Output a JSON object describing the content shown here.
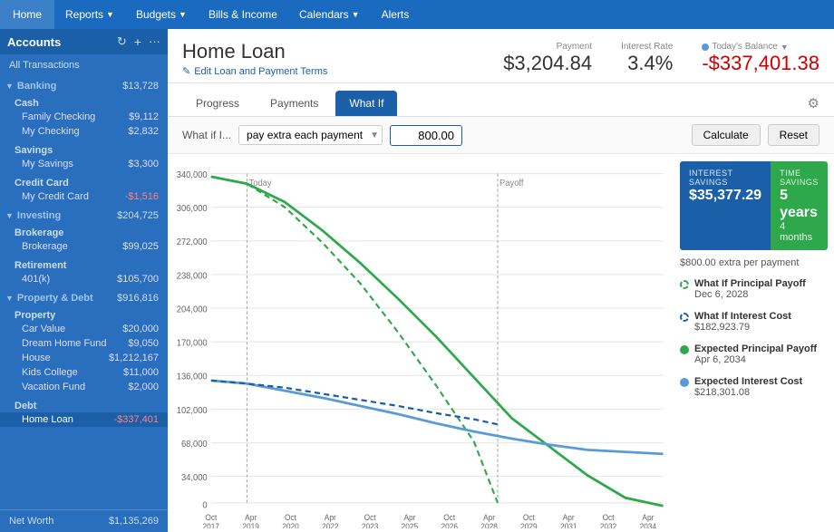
{
  "nav": {
    "items": [
      {
        "label": "Home",
        "active": false
      },
      {
        "label": "Reports",
        "hasMenu": true
      },
      {
        "label": "Budgets",
        "hasMenu": true
      },
      {
        "label": "Bills & Income",
        "hasMenu": false
      },
      {
        "label": "Calendars",
        "hasMenu": true
      },
      {
        "label": "Alerts",
        "hasMenu": false
      }
    ]
  },
  "sidebar": {
    "title": "Accounts",
    "all_transactions": "All Transactions",
    "groups": [
      {
        "name": "Banking",
        "total": "$13,728",
        "subgroups": [
          {
            "name": "Cash",
            "items": [
              {
                "name": "Family Checking",
                "amount": "$9,112"
              },
              {
                "name": "My Checking",
                "amount": "$2,832"
              }
            ]
          },
          {
            "name": "Savings",
            "items": [
              {
                "name": "My Savings",
                "amount": "$3,300"
              }
            ]
          },
          {
            "name": "Credit Card",
            "items": [
              {
                "name": "My Credit Card",
                "amount": "-$1,516",
                "negative": true
              }
            ]
          }
        ]
      },
      {
        "name": "Investing",
        "total": "$204,725",
        "subgroups": [
          {
            "name": "Brokerage",
            "items": [
              {
                "name": "Brokerage",
                "amount": "$99,025"
              }
            ]
          },
          {
            "name": "Retirement",
            "items": [
              {
                "name": "401(k)",
                "amount": "$105,700"
              }
            ]
          }
        ]
      },
      {
        "name": "Property & Debt",
        "total": "$916,816",
        "subgroups": [
          {
            "name": "Property",
            "items": [
              {
                "name": "Car Value",
                "amount": "$20,000"
              },
              {
                "name": "Dream Home Fund",
                "amount": "$9,050"
              },
              {
                "name": "House",
                "amount": "$1,212,167"
              },
              {
                "name": "Kids College",
                "amount": "$11,000"
              },
              {
                "name": "Vacation Fund",
                "amount": "$2,000"
              }
            ]
          },
          {
            "name": "Debt",
            "items": [
              {
                "name": "Home Loan",
                "amount": "-$337,401",
                "negative": true,
                "selected": true
              }
            ]
          }
        ]
      }
    ],
    "net_worth_label": "Net Worth",
    "net_worth_value": "$1,135,269"
  },
  "content": {
    "title": "Home Loan",
    "edit_label": "Edit Loan and Payment Terms",
    "payment_label": "Payment",
    "payment_value": "$3,204.84",
    "interest_rate_label": "Interest Rate",
    "interest_rate_value": "3.4%",
    "today_balance_label": "Today's Balance",
    "today_balance_value": "-$337,401.38",
    "tabs": [
      {
        "label": "Progress"
      },
      {
        "label": "Payments"
      },
      {
        "label": "What If",
        "active": true
      }
    ],
    "whatif": {
      "label": "What if I...",
      "select_value": "pay extra each payment",
      "input_value": "800.00",
      "calculate_label": "Calculate",
      "reset_label": "Reset"
    },
    "chart_sidebar": {
      "interest_savings_label": "INTEREST SAVINGS",
      "interest_savings_value": "$35,377.29",
      "time_savings_label": "TIME SAVINGS",
      "time_savings_value": "5 years",
      "time_savings_sub": "4 months",
      "extra_payment": "$800.00 extra per payment",
      "legend": [
        {
          "type": "dashed-green",
          "title": "What If Principal Payoff",
          "sub": "Dec 6, 2028"
        },
        {
          "type": "dashed-blue",
          "title": "What If Interest Cost",
          "sub": "$182,923.79"
        },
        {
          "type": "solid-green",
          "title": "Expected Principal Payoff",
          "sub": "Apr 6, 2034"
        },
        {
          "type": "solid-blue",
          "title": "Expected Interest Cost",
          "sub": "$218,301.08"
        }
      ]
    },
    "chart": {
      "y_labels": [
        "340,000",
        "306,000",
        "272,000",
        "238,000",
        "204,000",
        "170,000",
        "136,000",
        "102,000",
        "68,000",
        "34,000",
        "0"
      ],
      "x_labels": [
        "Oct\n2017",
        "Apr\n2019",
        "Oct\n2020",
        "Apr\n2022",
        "Oct\n2023",
        "Apr\n2025",
        "Oct\n2026",
        "Apr\n2028",
        "Oct\n2029",
        "Apr\n2031",
        "Oct\n2032",
        "Apr\n2034"
      ],
      "today_label": "Today",
      "payoff_label": "Payoff"
    }
  }
}
